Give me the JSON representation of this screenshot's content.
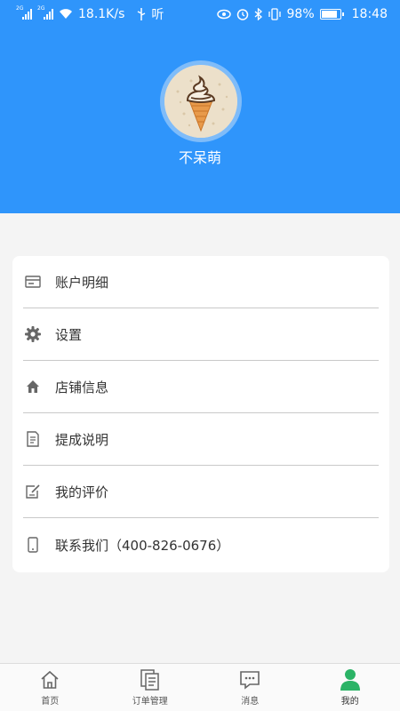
{
  "status_bar": {
    "network_tag_1": "2G",
    "network_tag_2": "2G",
    "speed": "18.1K/s",
    "extra": "听",
    "battery": "98%",
    "time": "18:48"
  },
  "profile": {
    "username": "不呆萌"
  },
  "menu": {
    "items": [
      {
        "label": "账户明细",
        "icon": "card-icon"
      },
      {
        "label": "设置",
        "icon": "gear-icon"
      },
      {
        "label": "店铺信息",
        "icon": "home-icon"
      },
      {
        "label": "提成说明",
        "icon": "document-icon"
      },
      {
        "label": "我的评价",
        "icon": "edit-icon"
      },
      {
        "label": "联系我们（400-826-0676）",
        "icon": "phone-icon"
      }
    ]
  },
  "bottom_nav": {
    "items": [
      {
        "label": "首页",
        "icon": "home-outline-icon"
      },
      {
        "label": "订单管理",
        "icon": "orders-icon"
      },
      {
        "label": "消息",
        "icon": "chat-icon"
      },
      {
        "label": "我的",
        "icon": "user-icon",
        "active": true
      }
    ]
  },
  "colors": {
    "header": "#2f95fb",
    "active_nav": "#2bb366"
  }
}
